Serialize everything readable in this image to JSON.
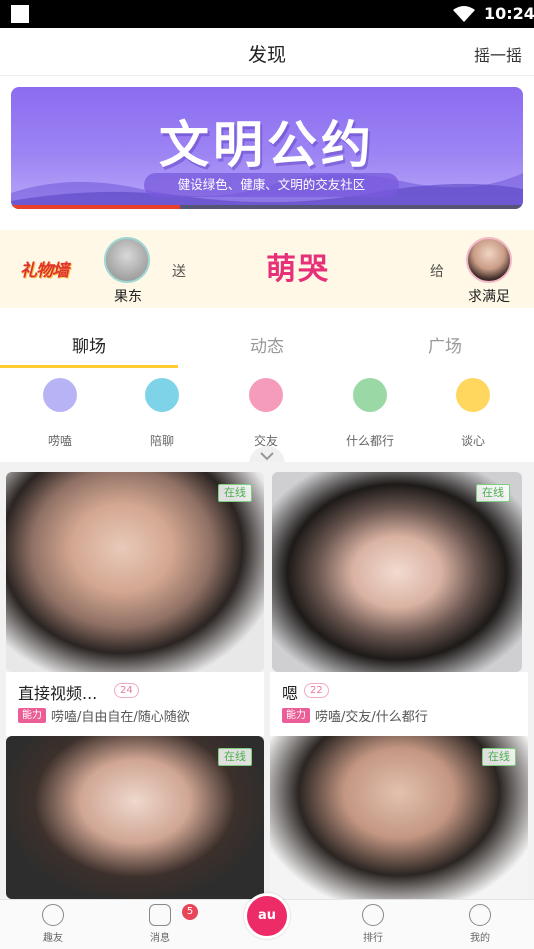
{
  "status_bar": {
    "time": "10:24"
  },
  "header": {
    "title": "发现",
    "shake_label": "摇一摇"
  },
  "banner": {
    "title": "文明公约",
    "subtitle": "健设绿色、健康、文明的交友社区",
    "carousel_progress": 0.33
  },
  "gift": {
    "logo_text": "礼物墙",
    "sender_name": "果东",
    "send_word": "送",
    "gift_name": "萌哭",
    "give_word": "给",
    "receiver_name": "求满足"
  },
  "tabs": [
    {
      "label": "聊场",
      "active": true
    },
    {
      "label": "动态",
      "active": false
    },
    {
      "label": "广场",
      "active": false
    }
  ],
  "categories": [
    {
      "label": "唠嗑",
      "icon": "chat-bubble-icon",
      "color": "#b7b3f5"
    },
    {
      "label": "陪聊",
      "icon": "glasses-icon",
      "color": "#7fd3e8"
    },
    {
      "label": "交友",
      "icon": "message-dots-icon",
      "color": "#f59bbb"
    },
    {
      "label": "什么都行",
      "icon": "layers-icon",
      "color": "#9ad9a6"
    },
    {
      "label": "谈心",
      "icon": "hearts-icon",
      "color": "#ffd75e"
    }
  ],
  "cards": [
    {
      "online": "在线",
      "name": "直接视频...",
      "count": "24",
      "ability": "能力",
      "tags": "唠嗑/自由自在/随心随欲"
    },
    {
      "online": "在线",
      "name": "嗯",
      "count": "22",
      "ability": "能力",
      "tags": "唠嗑/交友/什么都行"
    },
    {
      "online": "在线"
    },
    {
      "online": "在线"
    }
  ],
  "bottom_nav": {
    "items": [
      {
        "label": "趣友",
        "icon": "face-icon"
      },
      {
        "label": "消息",
        "icon": "message-icon",
        "badge": "5"
      },
      {
        "label": "排行",
        "icon": "medal-icon"
      },
      {
        "label": "我的",
        "icon": "profile-icon"
      }
    ],
    "center_label": "au",
    "center_icon": "video-chat-icon"
  }
}
